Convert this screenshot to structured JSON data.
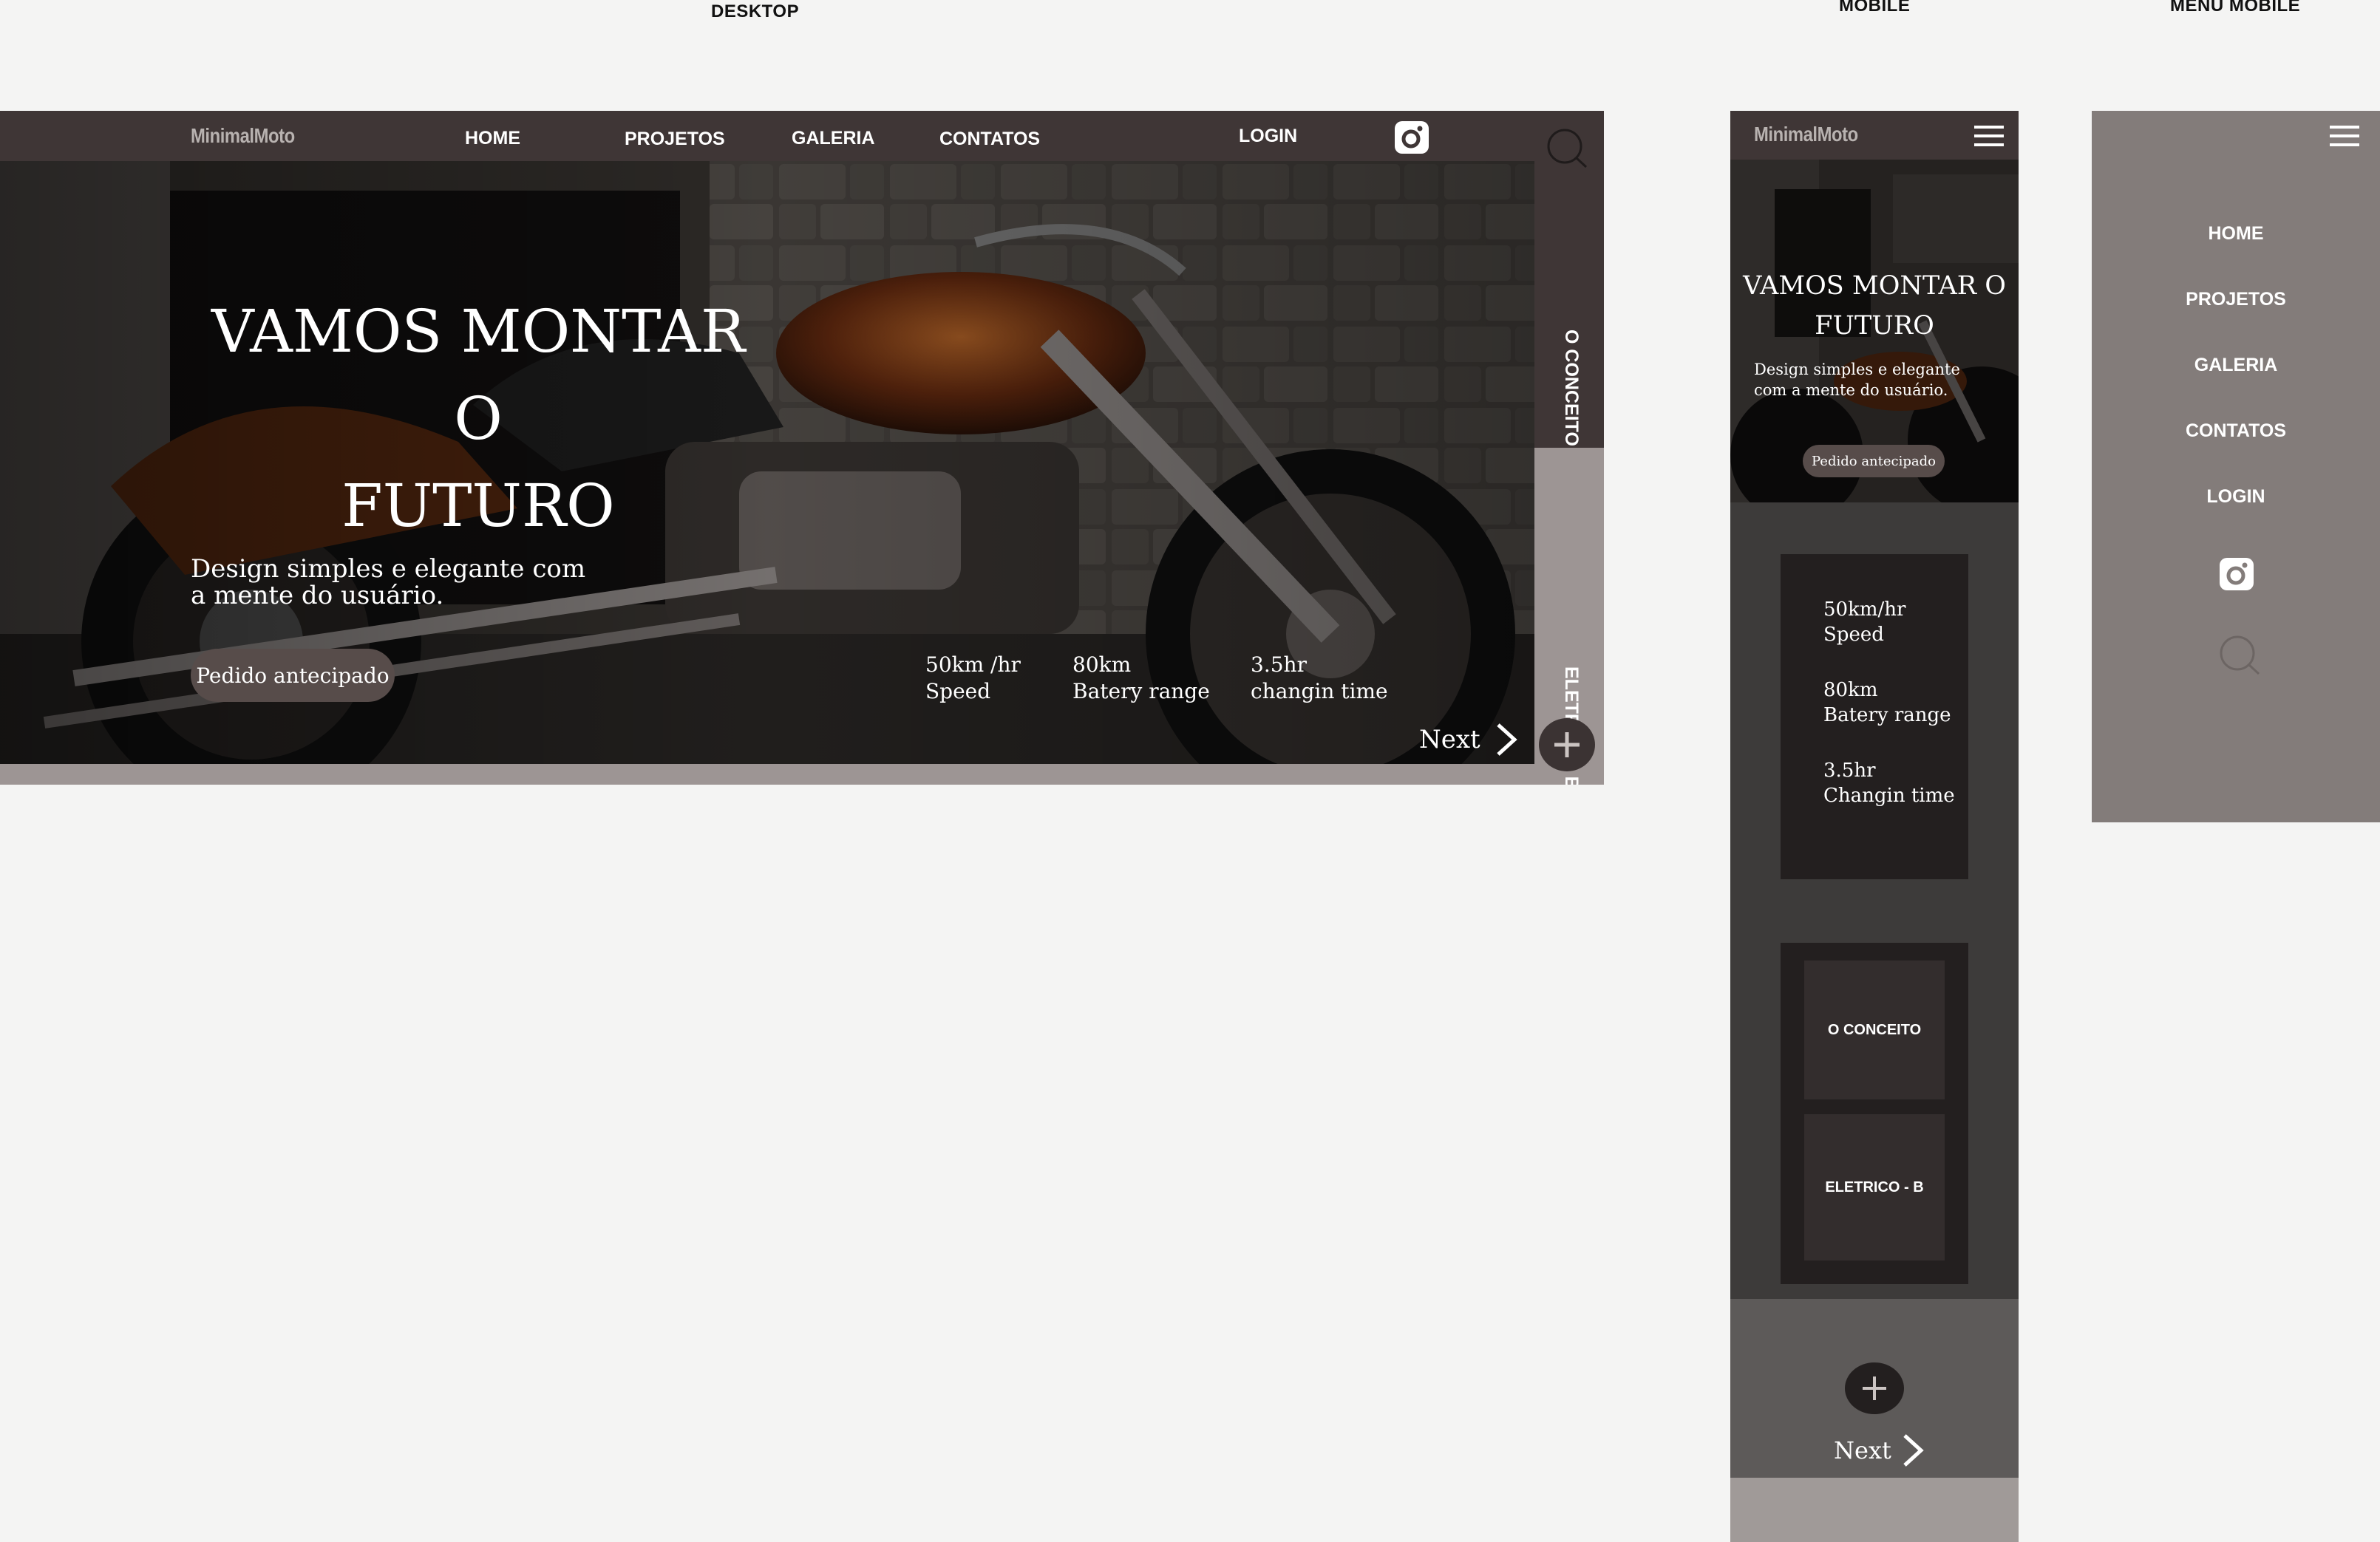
{
  "labels": {
    "desktop": "DESKTOP",
    "mobile": "MOBILE",
    "menu_mobile": "MENU MOBILE"
  },
  "brand": "MinimalMoto",
  "nav": {
    "home": "HOME",
    "projetos": "PROJETOS",
    "galeria": "GALERIA",
    "contatos": "CONTATOS",
    "login": "LOGIN"
  },
  "hero": {
    "title_line1": "VAMOS MONTAR O",
    "title_line2": "FUTURO",
    "subtitle_line1": "Design simples e elegante com",
    "subtitle_line2": "a mente do usuário.",
    "cta": "Pedido antecipado",
    "next": "Next"
  },
  "specs": {
    "speed_value": "50km /hr",
    "speed_label": "Speed",
    "range_value": "80km",
    "range_label": "Batery range",
    "charge_value": "3.5hr",
    "charge_label": "changin time"
  },
  "side_tabs": {
    "concept": "O CONCEITO",
    "electric": "ELETRICO - B"
  },
  "mobile": {
    "title_line1": "VAMOS MONTAR O",
    "title_line2": "FUTURO",
    "subtitle_line1": "Design simples e elegante",
    "subtitle_line2": "com a mente do usuário.",
    "cta": "Pedido antecipado",
    "speed_value": "50km/hr",
    "speed_label": "Speed",
    "range_value": "80km",
    "range_label": "Batery range",
    "charge_value": "3.5hr",
    "charge_label": "Changin time",
    "concept": "O CONCEITO",
    "electric": "ELETRICO - B",
    "next": "Next"
  },
  "colors": {
    "page_bg": "#f4f4f3",
    "nav_bg": "#3f3636",
    "tab_dark": "#3f3636",
    "tab_light": "#9d9594",
    "mobile_bg": "#3d3b3a",
    "menu_bg": "#837c7a",
    "cta_bg": "#574c4a"
  },
  "icons": [
    "instagram-icon",
    "search-icon",
    "hamburger-icon",
    "plus-icon",
    "chevron-right-icon"
  ]
}
